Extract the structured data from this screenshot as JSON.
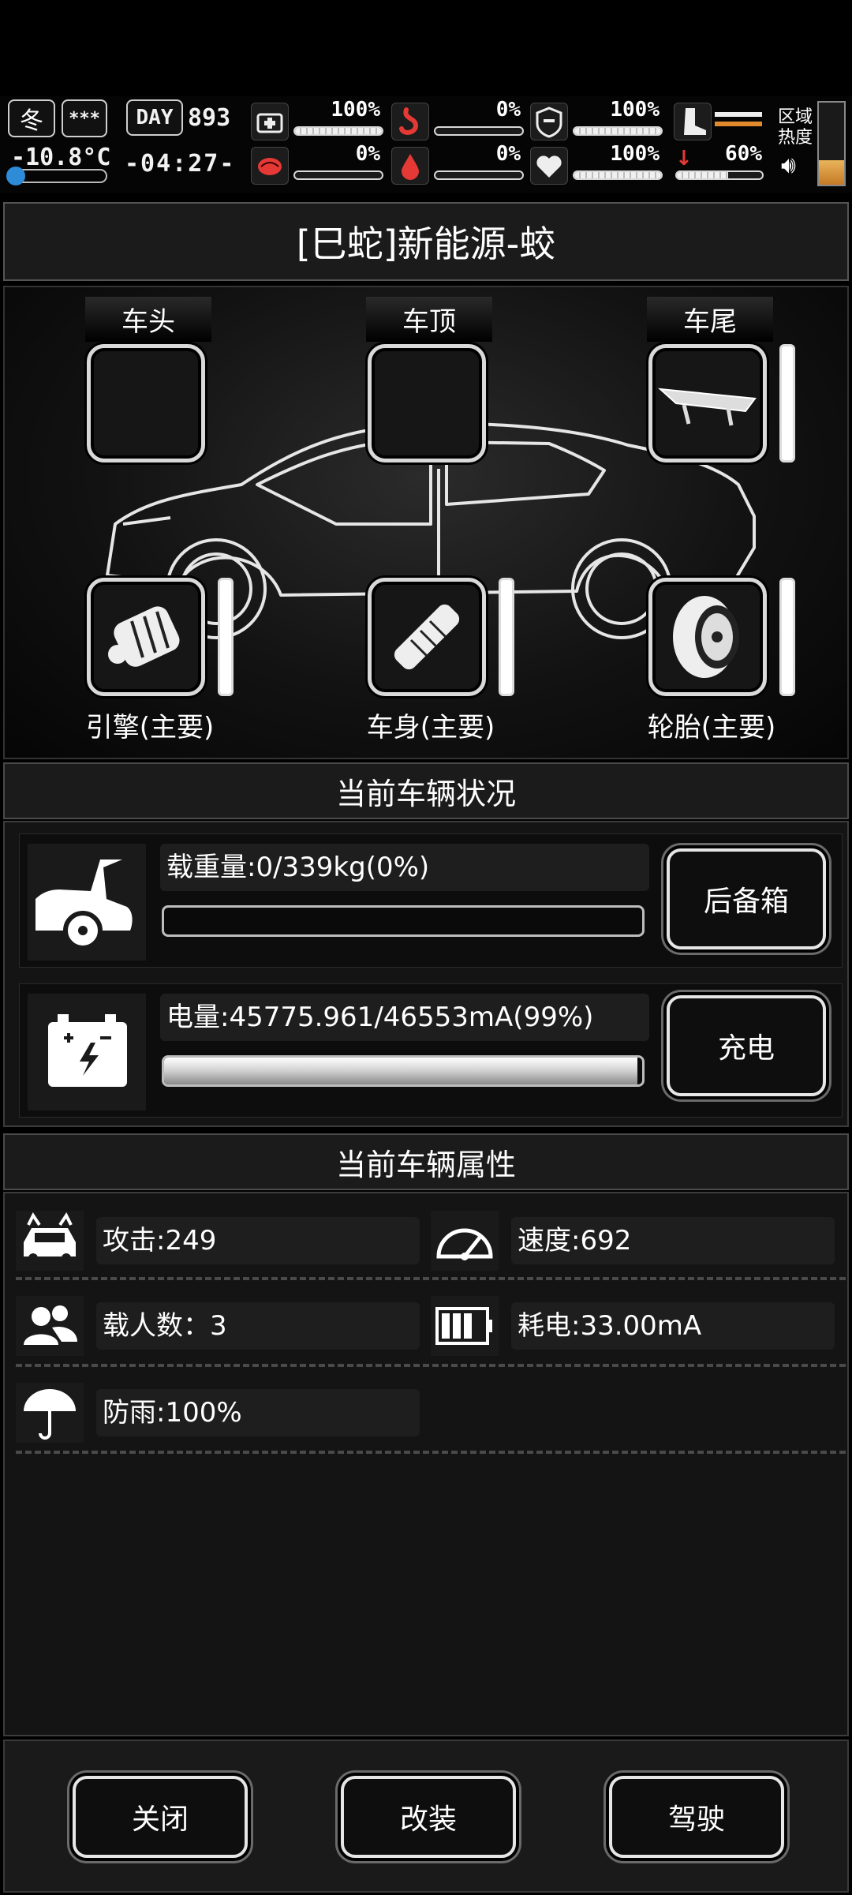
{
  "hud": {
    "season": "冬",
    "weather_symbol": "***",
    "temperature": "-10.8°C",
    "day_label": "DAY",
    "day_number": "893",
    "clock": "-04:27-",
    "stats": [
      {
        "icon": "first-aid-icon",
        "value": "100%",
        "fill": 1.0
      },
      {
        "icon": "stomach-icon",
        "value": "0%",
        "fill": 0.0,
        "color": "#e53935"
      },
      {
        "icon": "shield-icon",
        "value": "100%",
        "fill": 1.0
      },
      {
        "icon": "brain-icon",
        "value": "0%",
        "fill": 0.0,
        "color": "#e53935"
      },
      {
        "icon": "blood-drop-icon",
        "value": "0%",
        "fill": 0.0,
        "color": "#e53935"
      },
      {
        "icon": "heart-icon",
        "value": "100%",
        "fill": 1.0
      }
    ],
    "boot_value": "60%",
    "boot_fill": 0.6,
    "zone_label_line1": "区域",
    "zone_label_line2": "热度",
    "zone_heat_fill": 0.3
  },
  "vehicle": {
    "title": "[巳蛇]新能源-蛟"
  },
  "slots": {
    "front_label": "车头",
    "roof_label": "车顶",
    "rear_label": "车尾",
    "engine_label": "引擎(主要)",
    "body_label": "车身(主要)",
    "tire_label": "轮胎(主要)"
  },
  "status": {
    "header": "当前车辆状况",
    "load_text": "载重量:0/339kg(0%)",
    "load_fill": 0.0,
    "trunk_button": "后备箱",
    "battery_text": "电量:45775.961/46553mA(99%)",
    "battery_fill": 0.99,
    "charge_button": "充电"
  },
  "attributes": {
    "header": "当前车辆属性",
    "attack": "攻击:249",
    "speed": "速度:692",
    "passengers": "载人数：3",
    "power_use": "耗电:33.00mA",
    "rainproof": "防雨:100%"
  },
  "buttons": {
    "close": "关闭",
    "modify": "改装",
    "drive": "驾驶"
  },
  "colors": {
    "accent_red": "#e53935",
    "heat_orange": "#e08a2c"
  }
}
